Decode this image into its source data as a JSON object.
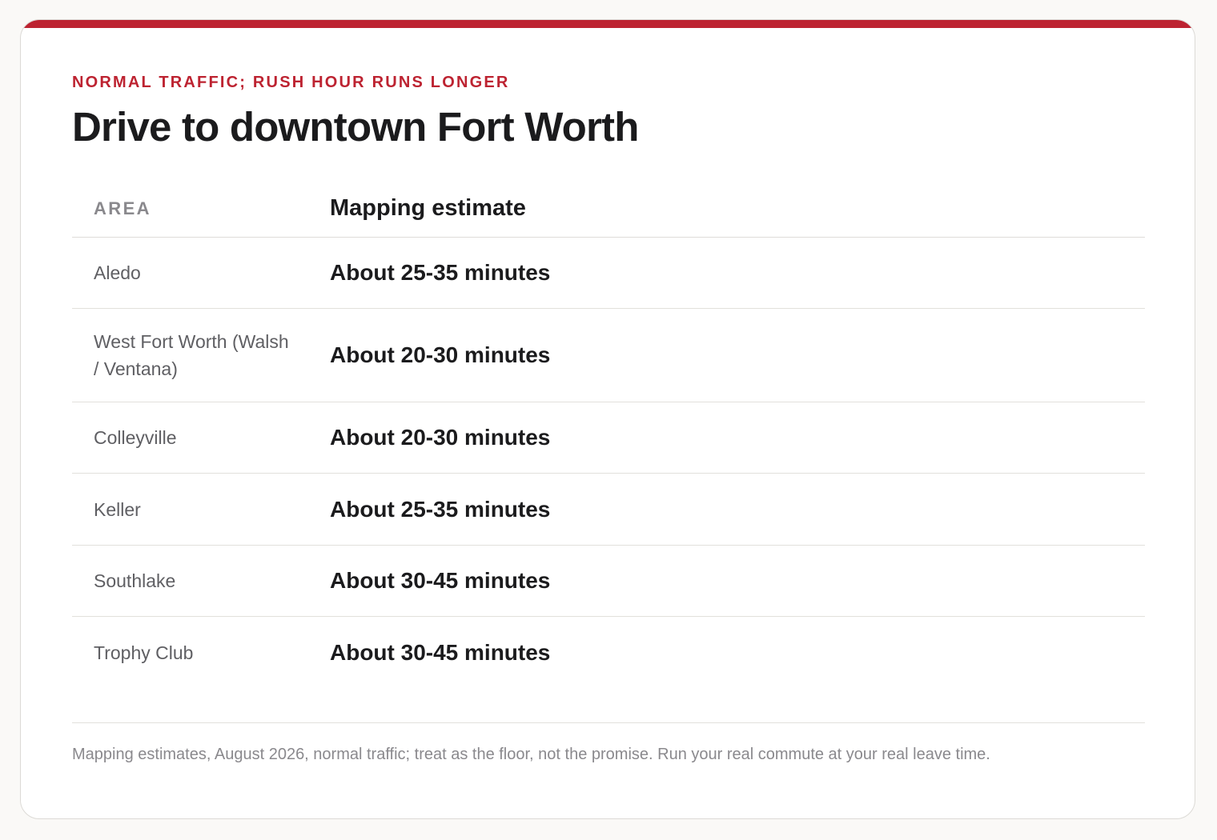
{
  "colors": {
    "accent": "#bd2331",
    "title": "#1b1b1d",
    "muted": "#8a898d",
    "area_text": "#5f5f63",
    "card_bg": "#ffffff",
    "page_bg": "#faf9f7"
  },
  "header": {
    "eyebrow": "NORMAL TRAFFIC; RUSH HOUR RUNS LONGER",
    "title": "Drive to downtown Fort Worth"
  },
  "table": {
    "columns": {
      "area": "AREA",
      "estimate": "Mapping estimate"
    },
    "rows": [
      {
        "area_line1": "Aledo",
        "area_line2": "",
        "estimate": "About 25-35 minutes"
      },
      {
        "area_line1": "West Fort Worth (Walsh",
        "area_line2": "/ Ventana)",
        "estimate": "About 20-30 minutes"
      },
      {
        "area_line1": "Colleyville",
        "area_line2": "",
        "estimate": "About 20-30 minutes"
      },
      {
        "area_line1": "Keller",
        "area_line2": "",
        "estimate": "About 25-35 minutes"
      },
      {
        "area_line1": "Southlake",
        "area_line2": "",
        "estimate": "About 30-45 minutes"
      },
      {
        "area_line1": "Trophy Club",
        "area_line2": "",
        "estimate": "About 30-45 minutes"
      }
    ]
  },
  "footnote": "Mapping estimates, August 2026, normal traffic; treat as the floor, not the promise. Run your real commute at your real leave time."
}
